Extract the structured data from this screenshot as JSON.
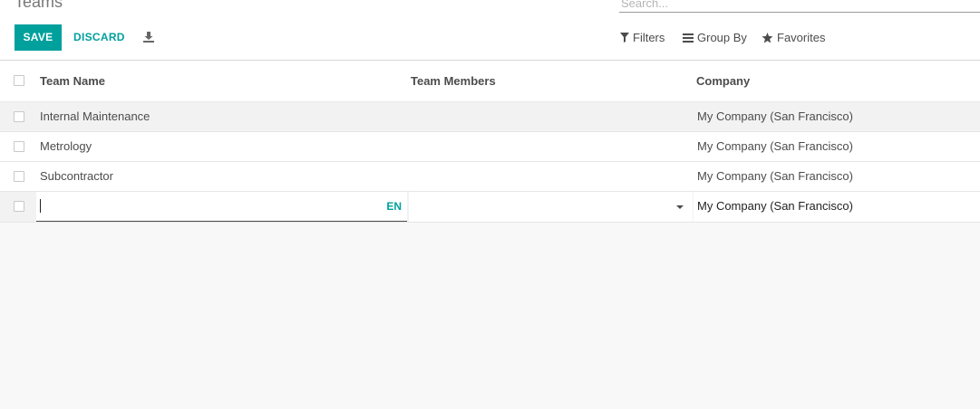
{
  "breadcrumb": "Teams",
  "search": {
    "placeholder": "Search..."
  },
  "buttons": {
    "save": "SAVE",
    "discard": "DISCARD"
  },
  "search_options": {
    "filters": "Filters",
    "group_by": "Group By",
    "favorites": "Favorites"
  },
  "columns": {
    "team_name": "Team Name",
    "team_members": "Team Members",
    "company": "Company"
  },
  "rows": [
    {
      "team_name": "Internal Maintenance",
      "team_members": "",
      "company": "My Company (San Francisco)"
    },
    {
      "team_name": "Metrology",
      "team_members": "",
      "company": "My Company (San Francisco)"
    },
    {
      "team_name": "Subcontractor",
      "team_members": "",
      "company": "My Company (San Francisco)"
    }
  ],
  "edit_row": {
    "team_name": "",
    "language": "EN",
    "team_members": "",
    "company": "My Company (San Francisco)"
  },
  "colors": {
    "accent": "#00a09d",
    "text": "#4c4c4c",
    "background": "#f8f8f8"
  }
}
